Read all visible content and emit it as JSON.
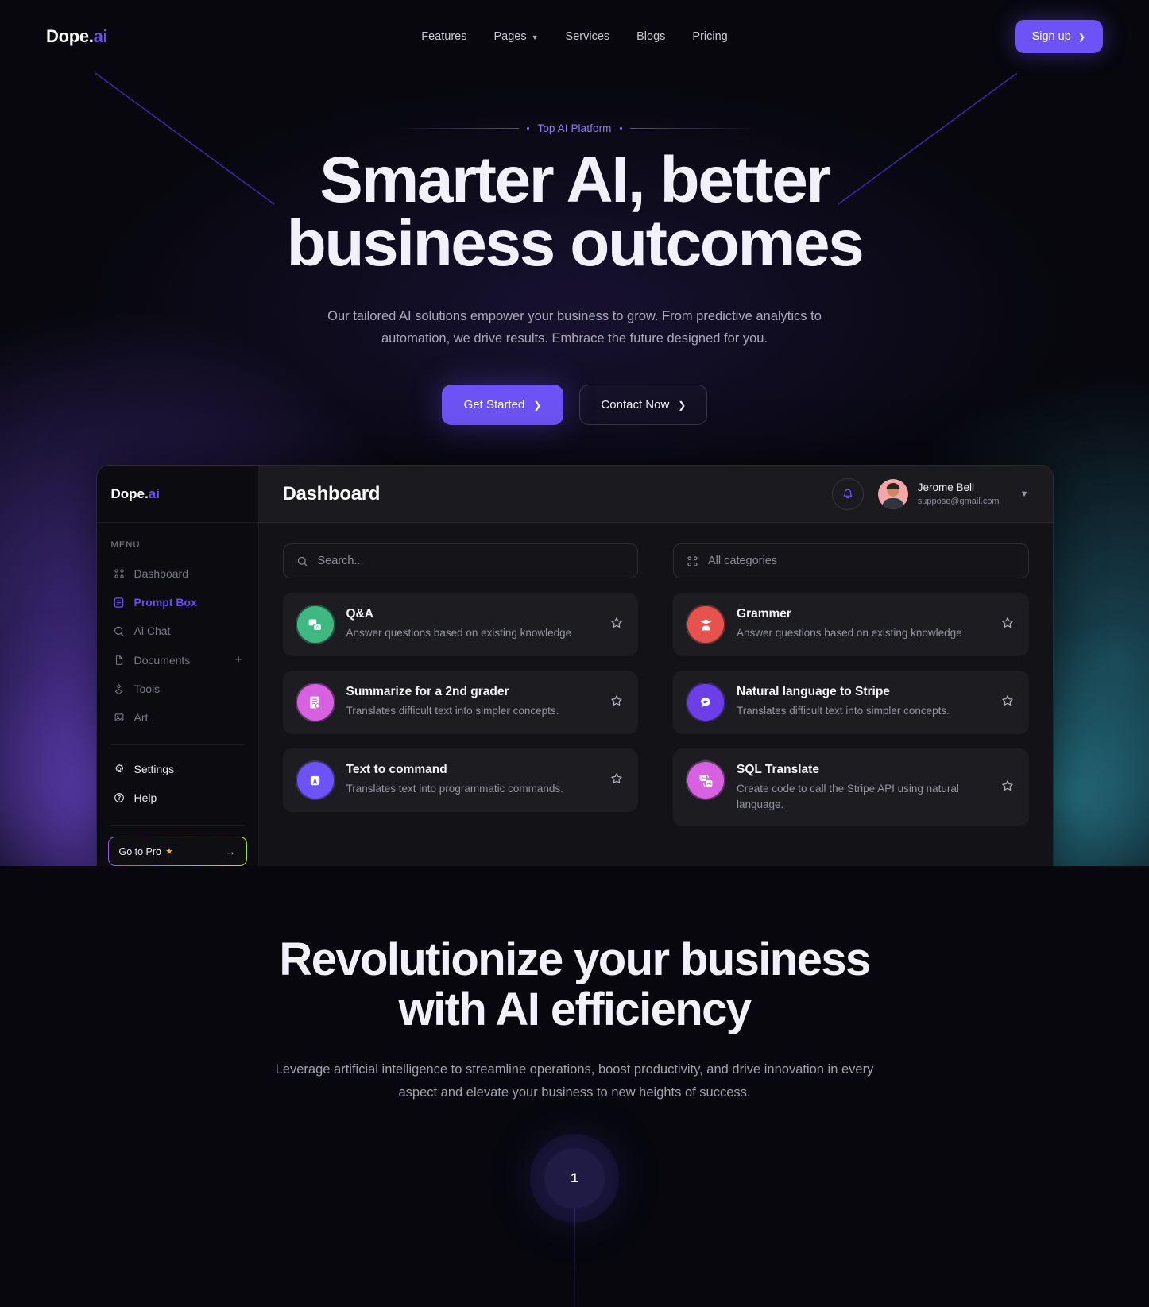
{
  "brand": {
    "name": "Dope.",
    "suffix": "ai"
  },
  "nav": {
    "links": [
      {
        "label": "Features",
        "icon": ""
      },
      {
        "label": "Pages",
        "icon": "chevron-down-icon"
      },
      {
        "label": "Services",
        "icon": ""
      },
      {
        "label": "Blogs",
        "icon": ""
      },
      {
        "label": "Pricing",
        "icon": ""
      }
    ],
    "signup_label": "Sign up"
  },
  "hero": {
    "eyebrow": "Top AI Platform",
    "title_line1": "Smarter AI, better",
    "title_line2": "business outcomes",
    "subtitle": "Our tailored AI solutions empower your business to grow. From predictive analytics to automation, we drive results. Embrace the future designed for you.",
    "primary_cta": "Get Started",
    "secondary_cta": "Contact Now"
  },
  "dashboard": {
    "sidebar": {
      "logo": "Dope.",
      "logo_suffix": "ai",
      "menu_label": "MENU",
      "items": [
        {
          "label": "Dashboard",
          "icon": "grid-icon",
          "state": "default"
        },
        {
          "label": "Prompt Box",
          "icon": "prompt-icon",
          "state": "active"
        },
        {
          "label": "Ai Chat",
          "icon": "chat-icon",
          "state": "default"
        },
        {
          "label": "Documents",
          "icon": "document-icon",
          "state": "default",
          "action": "+"
        },
        {
          "label": "Tools",
          "icon": "tools-icon",
          "state": "default"
        },
        {
          "label": "Art",
          "icon": "image-icon",
          "state": "default"
        }
      ],
      "footer_items": [
        {
          "label": "Settings",
          "icon": "gear-icon"
        },
        {
          "label": "Help",
          "icon": "help-icon"
        }
      ],
      "go_pro": {
        "label": "Go to Pro",
        "star": "★",
        "arrow": "→"
      }
    },
    "header": {
      "title": "Dashboard",
      "bell": "bell-icon",
      "user_name": "Jerome Bell",
      "user_email": "suppose@gmail.com",
      "caret": "chevron-down-icon"
    },
    "search": {
      "placeholder": "Search...",
      "icon": "search-icon"
    },
    "categories": {
      "value": "All categories",
      "icon": "grid-icon"
    },
    "cards_left": [
      {
        "title": "Q&A",
        "desc": "Answer questions based on existing knowledge",
        "icon": "qa-icon",
        "color": "#3fb982"
      },
      {
        "title": "Summarize for a 2nd grader",
        "desc": "Translates difficult text into simpler concepts.",
        "icon": "summary-icon",
        "color": "#d761e0"
      },
      {
        "title": "Text to command",
        "desc": "Translates text into programmatic commands.",
        "icon": "command-icon",
        "color": "#6d53f5"
      }
    ],
    "cards_right": [
      {
        "title": "Grammer",
        "desc": "Answer questions based on existing knowledge",
        "icon": "graduate-icon",
        "color": "#e8524c"
      },
      {
        "title": "Natural language to Stripe",
        "desc": "Translates difficult text into simpler concepts.",
        "icon": "bubble-icon",
        "color": "#6b3ee8"
      },
      {
        "title": "SQL Translate",
        "desc": "Create code to call the Stripe API using natural language.",
        "icon": "translate-icon",
        "color": "#d761e0"
      }
    ]
  },
  "section2": {
    "title_line1": "Revolutionize your business",
    "title_line2": "with AI efficiency",
    "subtitle": "Leverage artificial intelligence to streamline operations, boost productivity, and drive innovation in every aspect and elevate your business to new heights of success.",
    "step_number": "1"
  },
  "colors": {
    "accent": "#6d53f5",
    "accent_text": "#8d79f6",
    "background": "#07070d",
    "panel": "#131317",
    "card": "#1c1c21"
  }
}
